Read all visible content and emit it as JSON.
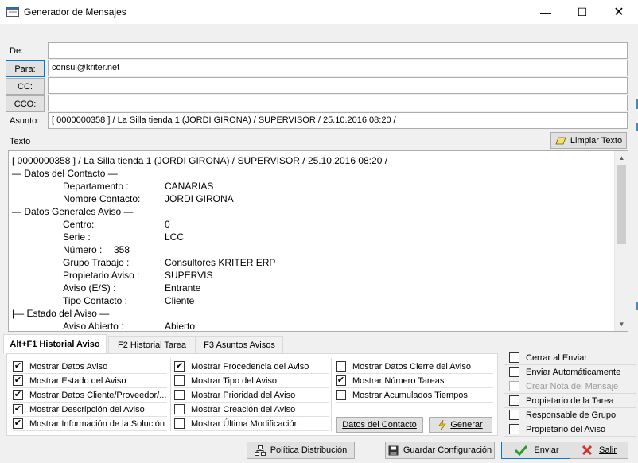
{
  "window": {
    "title": "Generador de Mensajes",
    "minimize": "—",
    "maximize": "☐",
    "close": "✕"
  },
  "header": {
    "de_label": "De:",
    "de_value": "",
    "para_button": "Para:",
    "para_value": "consul@kriter.net",
    "cc_button": "CC:",
    "cc_value": "",
    "cco_button": "CCO:",
    "cco_value": "",
    "asunto_label": "Asunto:",
    "asunto_value": "[ 0000000358 ] / La Silla tienda 1 (JORDI GIRONA) / SUPERVISOR / 25.10.2016 08:20 /"
  },
  "texto": {
    "label": "Texto",
    "limpiar_button": "Limpiar Texto",
    "lines": [
      {
        "text": "[ 0000000358 ] / La Silla tienda 1 (JORDI GIRONA) / SUPERVISOR / 25.10.2016 08:20 /"
      },
      {
        "text": "— Datos del Contacto —"
      },
      {
        "key": "Departamento :",
        "value": "CANARIAS"
      },
      {
        "key": "Nombre Contacto:",
        "value": "JORDI GIRONA"
      },
      {
        "text": "— Datos Generales Aviso —"
      },
      {
        "key": "Centro:",
        "value": "0"
      },
      {
        "key": "Serie :",
        "value": "LCC"
      },
      {
        "key": "Número :",
        "value": "358"
      },
      {
        "key": "Grupo Trabajo :",
        "value": "Consultores KRITER ERP"
      },
      {
        "key": "Propietario Aviso :",
        "value": "SUPERVIS"
      },
      {
        "key": "Aviso (E/S) :",
        "value": "Entrante"
      },
      {
        "key": "Tipo Contacto :",
        "value": "Cliente"
      },
      {
        "text": "|— Estado del Aviso —"
      },
      {
        "key": "Aviso Abierto :",
        "value": "Abierto"
      }
    ],
    "scroll_up": "▲",
    "scroll_down": "▼"
  },
  "tabs": [
    {
      "label": "Alt+F1 Historial Aviso",
      "active": true
    },
    {
      "label": "F2 Historial Tarea",
      "active": false
    },
    {
      "label": "F3 Asuntos Avisos",
      "active": false
    }
  ],
  "options": {
    "col1": [
      {
        "label": "Mostrar Datos Aviso",
        "checked": true
      },
      {
        "label": "Mostrar Estado del Aviso",
        "checked": true
      },
      {
        "label": "Mostrar Datos Cliente/Proveedor/...",
        "checked": true
      },
      {
        "label": "Mostrar Descripción del Aviso",
        "checked": true
      },
      {
        "label": "Mostrar Información de la Solución",
        "checked": true
      }
    ],
    "col2": [
      {
        "label": "Mostrar Procedencia del Aviso",
        "checked": true
      },
      {
        "label": "Mostrar Tipo del Aviso",
        "checked": false
      },
      {
        "label": "Mostrar Prioridad del Aviso",
        "checked": false
      },
      {
        "label": "Mostrar Creación del Aviso",
        "checked": false
      },
      {
        "label": "Mostrar Última Modificación",
        "checked": false
      }
    ],
    "col3": [
      {
        "label": "Mostrar Datos Cierre del Aviso",
        "checked": false
      },
      {
        "label": "Mostrar Número Tareas",
        "checked": true
      },
      {
        "label": "Mostrar Acumulados Tiempos",
        "checked": false
      }
    ],
    "datos_contacto_button": "Datos del Contacto",
    "generar_button": "Generar"
  },
  "right_options": [
    {
      "label": "Cerrar al Enviar",
      "checked": false,
      "disabled": false
    },
    {
      "label": "Enviar Automáticamente",
      "checked": false,
      "disabled": false
    },
    {
      "label": "Crear Nota del Mensaje",
      "checked": false,
      "disabled": true
    },
    {
      "label": "Propietario de la Tarea",
      "checked": false,
      "disabled": false
    },
    {
      "label": "Responsable de Grupo",
      "checked": false,
      "disabled": false
    },
    {
      "label": "Propietario del Aviso",
      "checked": false,
      "disabled": false
    }
  ],
  "footer": {
    "politica_button": "Política Distribución",
    "guardar_button": "Guardar Configuración",
    "enviar_button": "Enviar",
    "salir_button": "Salir"
  },
  "colors": {
    "accent": "#0078d7",
    "check_green": "#2e9a2e",
    "close_red": "#d32f2f"
  }
}
